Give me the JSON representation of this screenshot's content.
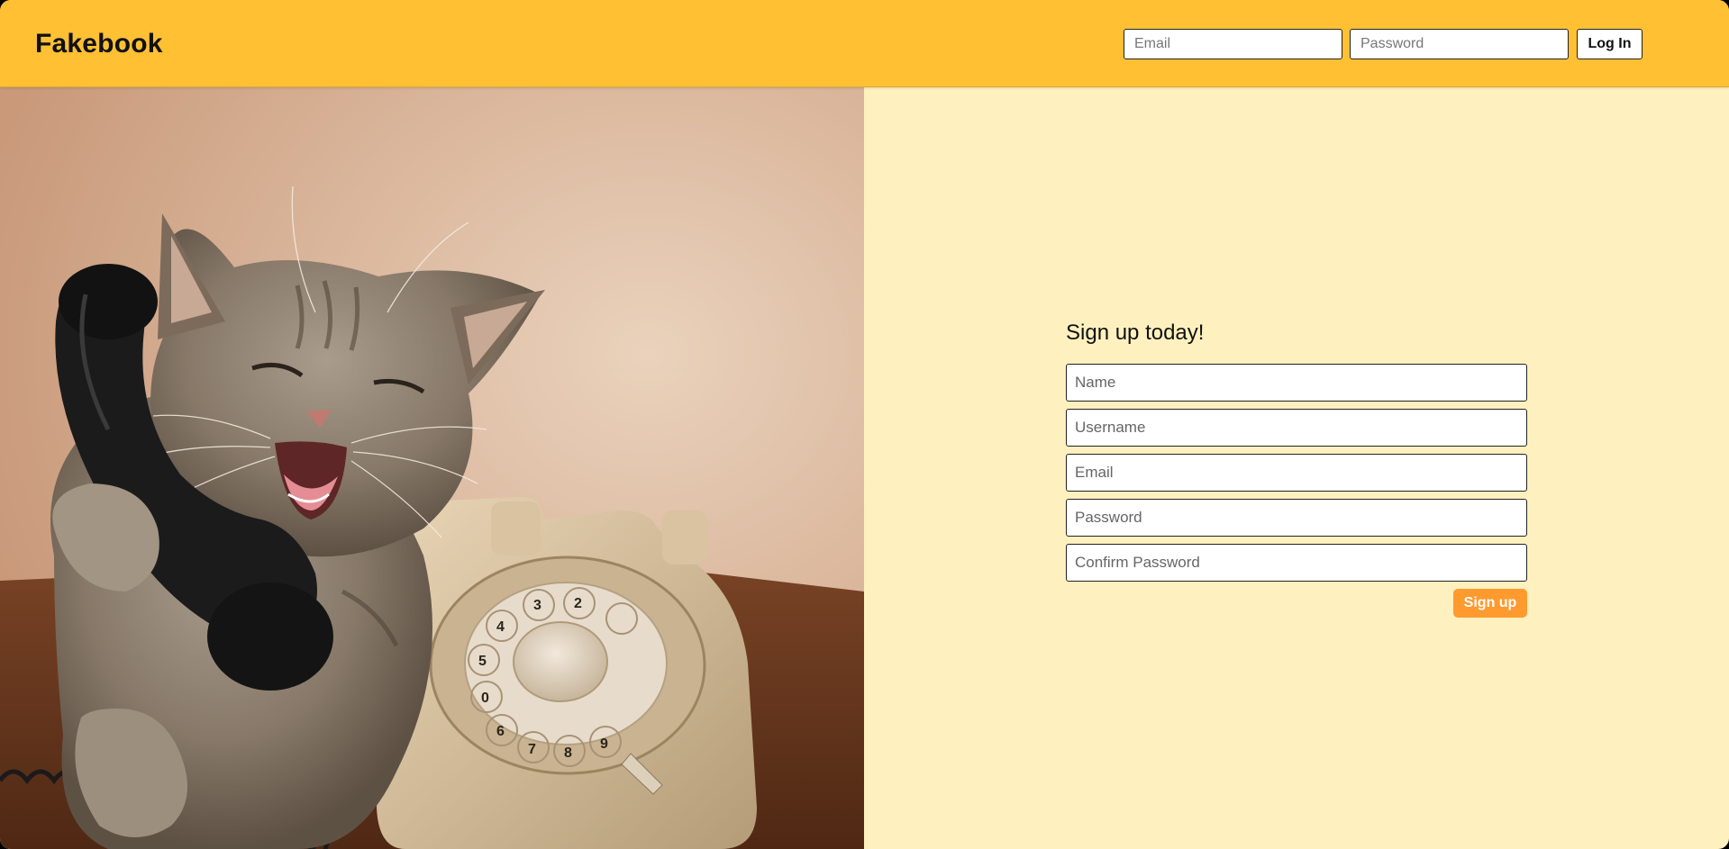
{
  "header": {
    "logo": "Fakebook",
    "email_placeholder": "Email",
    "password_placeholder": "Password",
    "login_label": "Log In"
  },
  "hero_image": {
    "subject": "kitten-on-rotary-phone",
    "dial_digits": [
      "6",
      "7",
      "8",
      "9",
      "0",
      "5",
      "4",
      "3",
      "2"
    ]
  },
  "signup": {
    "title": "Sign up today!",
    "fields": {
      "name": "Name",
      "username": "Username",
      "email": "Email",
      "password": "Password",
      "confirm_password": "Confirm Password"
    },
    "submit_label": "Sign up"
  },
  "colors": {
    "header": "#ffc034",
    "background": "#fff1bf",
    "signup_button": "#ff9a2e"
  }
}
